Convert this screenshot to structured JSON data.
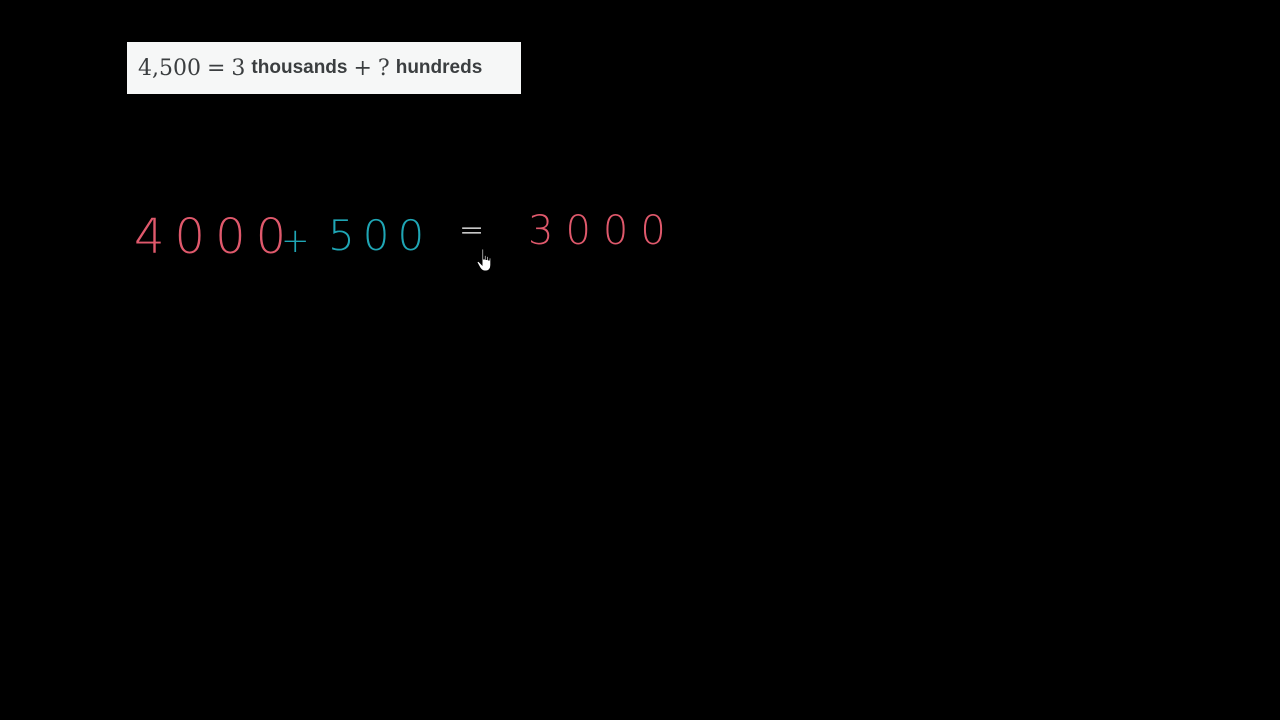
{
  "problem": {
    "lhs": "4,500",
    "equals": "=",
    "thousands_count": "3",
    "thousands_word": "thousands",
    "plus": "+",
    "unknown": "?",
    "hundreds_word": "hundreds"
  },
  "board": {
    "term1": "4000",
    "plus": "+",
    "term2": "500",
    "equals": "=",
    "term3": "3000"
  },
  "colors": {
    "background": "#000000",
    "problem_bg": "#f6f7f7",
    "problem_text": "#3b3e40",
    "red_ink": "#e0596c",
    "teal_ink": "#1fa6b5",
    "white_ink": "#ffffff"
  },
  "cursor": {
    "icon": "hand-pointer-icon"
  }
}
